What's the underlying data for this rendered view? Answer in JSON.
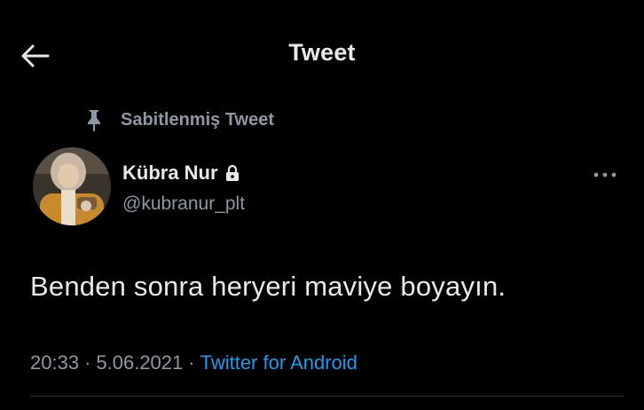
{
  "header": {
    "title": "Tweet",
    "back_icon": "arrow-left-icon"
  },
  "pinned": {
    "label": "Sabitlenmiş Tweet",
    "icon": "pin-icon"
  },
  "author": {
    "display_name": "Kübra Nur",
    "username": "@kubranur_plt",
    "protected_icon": "lock-icon"
  },
  "tweet": {
    "text": "Benden sonra heryeri maviye boyayın.",
    "time": "20:33",
    "separator": "·",
    "date": "5.06.2021",
    "source": "Twitter for Android"
  },
  "colors": {
    "background": "#000000",
    "text_primary": "#e7e9ea",
    "text_secondary": "#8b98a5",
    "link": "#1d9bf0"
  }
}
